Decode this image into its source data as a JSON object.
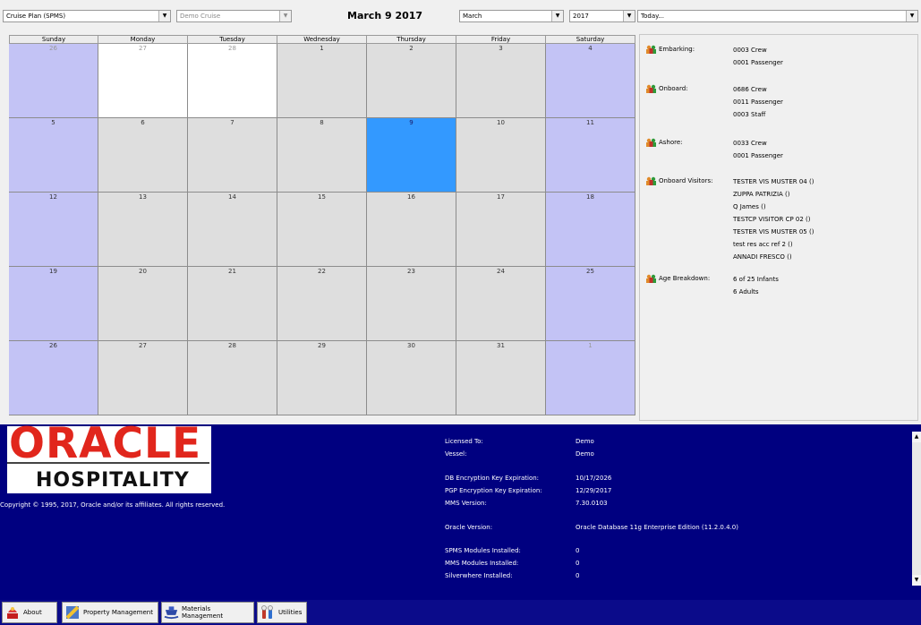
{
  "toolbar": {
    "plan_value": "Cruise Plan (SPMS)",
    "cruise_value": "Demo Cruise",
    "title": "March 9 2017",
    "month_value": "March",
    "year_value": "2017",
    "today_value": "Today..."
  },
  "calendar": {
    "weekdays": [
      "Sunday",
      "Monday",
      "Tuesday",
      "Wednesday",
      "Thursday",
      "Friday",
      "Saturday"
    ],
    "weeks": [
      [
        "26",
        "27",
        "28",
        "1",
        "2",
        "3",
        "4"
      ],
      [
        "5",
        "6",
        "7",
        "8",
        "9",
        "10",
        "11"
      ],
      [
        "12",
        "13",
        "14",
        "15",
        "16",
        "17",
        "18"
      ],
      [
        "19",
        "20",
        "21",
        "22",
        "23",
        "24",
        "25"
      ],
      [
        "26",
        "27",
        "28",
        "29",
        "30",
        "31",
        "1"
      ]
    ],
    "selected_day": "9",
    "colors": {
      "weekend": "#c3c3f5",
      "weekday": "#dedede",
      "other_month": "#ffffff",
      "selected": "#3399ff"
    }
  },
  "info": {
    "sections": [
      {
        "label": "Embarking:",
        "values": [
          "0003 Crew",
          "0001 Passenger"
        ]
      },
      {
        "label": "Onboard:",
        "values": [
          "0686 Crew",
          "0011 Passenger",
          "0003 Staff"
        ]
      },
      {
        "label": "Ashore:",
        "values": [
          "0033 Crew",
          "0001 Passenger"
        ]
      },
      {
        "label": "Onboard Visitors:",
        "values": [
          "TESTER VIS MUSTER 04 ()",
          "ZUPPA PATRIZIA ()",
          "Q James ()",
          "TESTCP VISITOR CP 02 ()",
          "TESTER VIS MUSTER 05 ()",
          "test res acc ref 2 ()",
          "ANNADI FRESCO ()"
        ]
      },
      {
        "label": "Age Breakdown:",
        "values": [
          "6 of 25 Infants",
          "6 Adults"
        ]
      }
    ]
  },
  "banner": {
    "logo_text": "ORACLE",
    "logo_sub": "HOSPITALITY",
    "copyright": "Copyright © 1995, 2017, Oracle and/or its affiliates. All rights reserved.",
    "licensed_to_label": "Licensed To:",
    "licensed_to_value": "Demo",
    "vessel_label": "Vessel:",
    "vessel_value": "Demo",
    "db_key_label": "DB Encryption Key Expiration:",
    "db_key_value": "10/17/2026",
    "pgp_key_label": "PGP Encryption Key Expiration:",
    "pgp_key_value": "12/29/2017",
    "mms_label": "MMS Version:",
    "mms_value": "7.30.0103",
    "oracle_label": "Oracle Version:",
    "oracle_value": "Oracle Database 11g Enterprise Edition (11.2.0.4.0)",
    "spms_label": "SPMS Modules Installed:",
    "spms_value": "0",
    "mms_mod_label": "MMS Modules Installed:",
    "mms_mod_value": "0",
    "silver_label": "Silverwhere Installed:",
    "silver_value": "0"
  },
  "taskbar": {
    "about": "About",
    "property": "Property Management",
    "materials": "Materials Management",
    "utilities": "Utilities"
  }
}
